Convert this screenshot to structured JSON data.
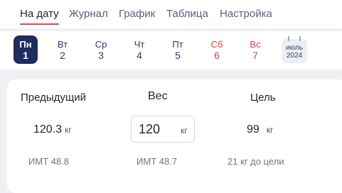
{
  "tabs": [
    {
      "label": "На дату",
      "active": true
    },
    {
      "label": "Журнал",
      "active": false
    },
    {
      "label": "График",
      "active": false
    },
    {
      "label": "Таблица",
      "active": false
    },
    {
      "label": "Настройка",
      "active": false
    }
  ],
  "week": {
    "days": [
      {
        "name": "Пн",
        "date": "1",
        "selected": true,
        "weekend": false
      },
      {
        "name": "Вт",
        "date": "2",
        "selected": false,
        "weekend": false
      },
      {
        "name": "Ср",
        "date": "3",
        "selected": false,
        "weekend": false
      },
      {
        "name": "Чт",
        "date": "4",
        "selected": false,
        "weekend": false
      },
      {
        "name": "Пт",
        "date": "5",
        "selected": false,
        "weekend": false
      },
      {
        "name": "Сб",
        "date": "6",
        "selected": false,
        "weekend": true
      },
      {
        "name": "Вс",
        "date": "7",
        "selected": false,
        "weekend": true
      }
    ],
    "month_button": {
      "month": "июль",
      "year": "2024",
      "icon": "calendar-icon"
    }
  },
  "summary": {
    "previous": {
      "title": "Предыдущий",
      "value": "120.3",
      "unit": "кг",
      "bmi": "ИМТ 48.8"
    },
    "weight": {
      "title": "Вес",
      "value": "120",
      "unit": "кг",
      "bmi": "ИМТ 48.7"
    },
    "goal": {
      "title": "Цель",
      "value": "99",
      "unit": "кг",
      "remaining": "21 кг до цели"
    }
  },
  "colors": {
    "accent_underline": "#e64545",
    "selected_day_bg": "#1e2d5e",
    "weekend": "#e23b3b"
  }
}
